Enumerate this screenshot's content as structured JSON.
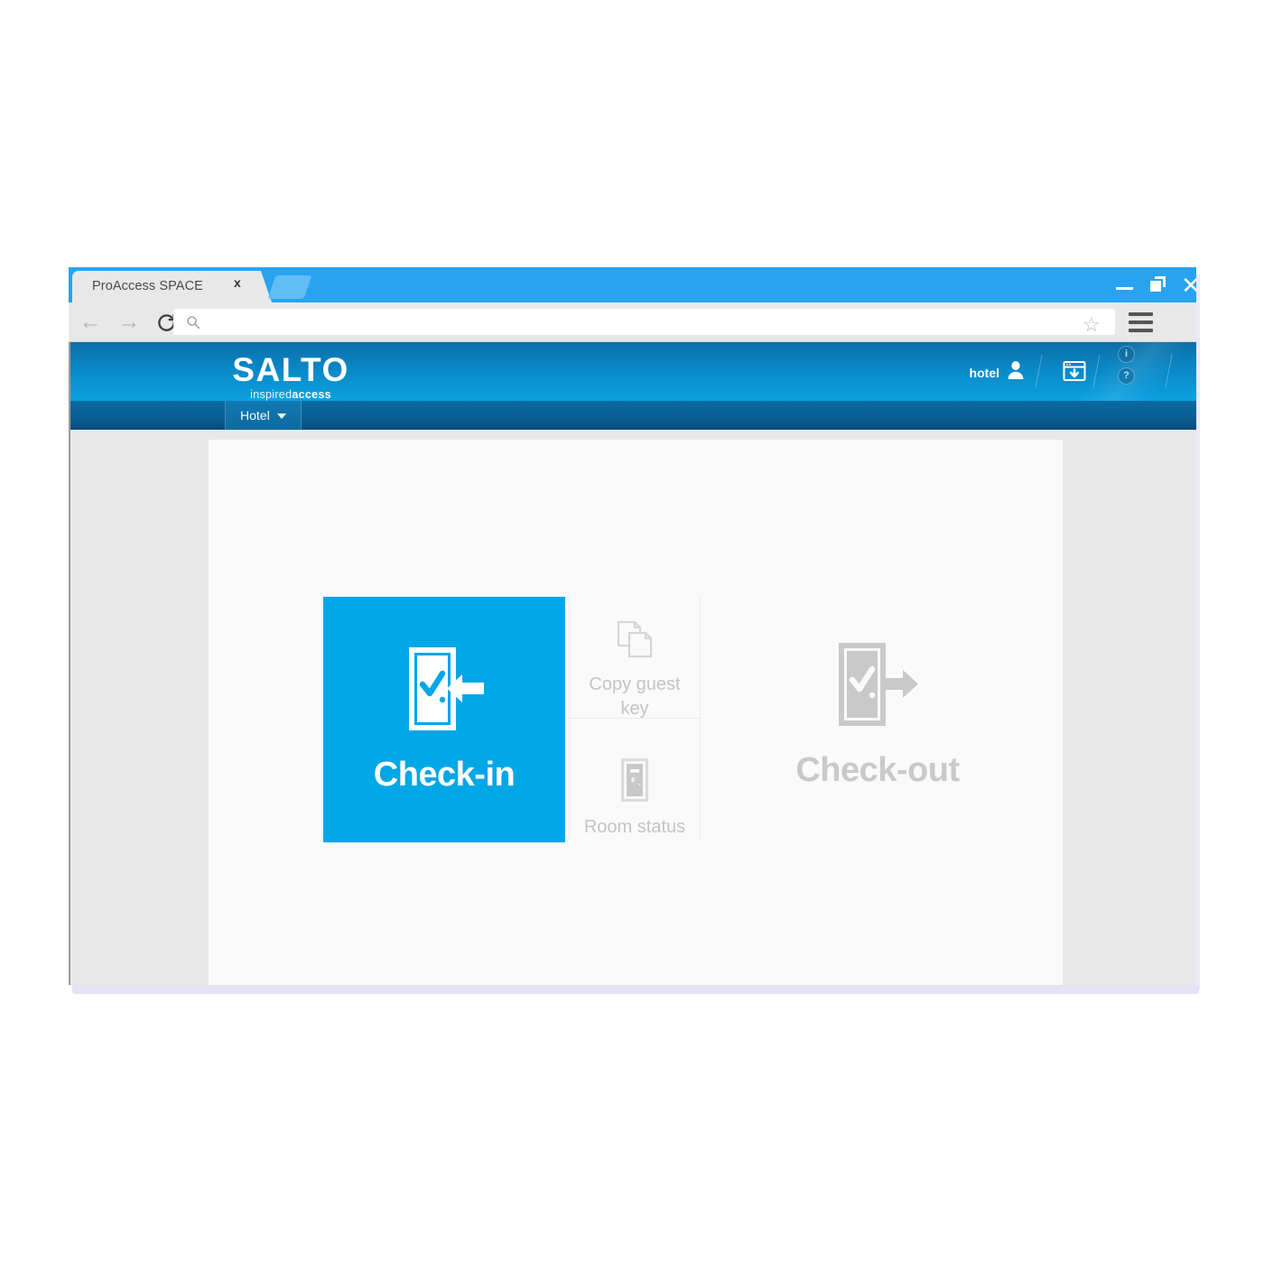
{
  "browser": {
    "tab": {
      "title": "ProAccess SPACE",
      "close_label": "x"
    },
    "new_tab_label": "",
    "window_controls": {
      "minimize": "minimize-icon",
      "maximize": "maximize-icon",
      "close": "✕"
    },
    "toolbar": {
      "back": "←",
      "forward": "→",
      "reload": "reload-icon",
      "address_value": "",
      "address_placeholder": "",
      "search_icon": "search-icon",
      "bookmark_icon": "☆",
      "menu_icon": "hamburger-menu-icon"
    }
  },
  "app": {
    "header": {
      "logo_wordmark": "SALTO",
      "tagline_light": "inspired",
      "tagline_bold": "access",
      "user_label": "hotel",
      "user_icon": "user-icon",
      "download_icon": "download-window-icon",
      "info_badge": "i",
      "help_badge": "?"
    },
    "nav": {
      "items": [
        {
          "label": "Hotel",
          "icon": "chevron-down-icon"
        }
      ]
    },
    "main": {
      "tiles": [
        {
          "id": "check-in",
          "label": "Check-in",
          "icon": "door-check-arrow-in-icon",
          "state": "active",
          "color": "#00a7e7"
        },
        {
          "id": "copy-guest-key",
          "label": "Copy guest key",
          "icon": "copy-documents-icon",
          "state": "disabled",
          "color": "#c4c4c4"
        },
        {
          "id": "room-status",
          "label": "Room status",
          "icon": "door-icon",
          "state": "disabled",
          "color": "#c4c4c4"
        },
        {
          "id": "check-out",
          "label": "Check-out",
          "icon": "door-check-arrow-out-icon",
          "state": "disabled",
          "color": "#c9c9c9"
        }
      ]
    }
  }
}
